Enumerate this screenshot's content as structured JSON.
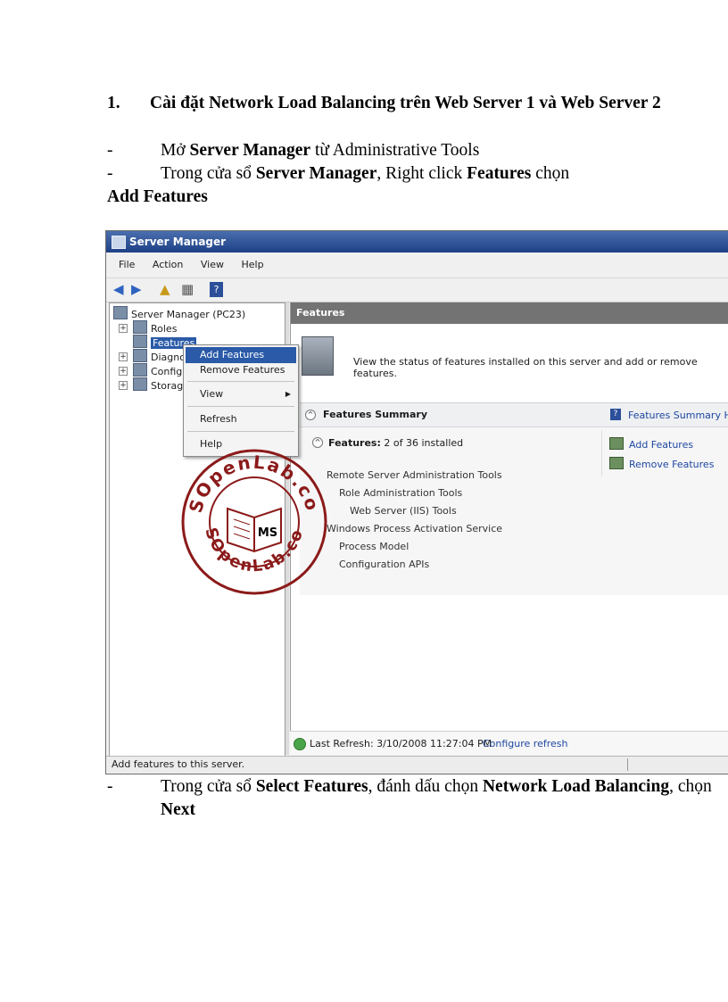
{
  "doc": {
    "heading_num": "1.",
    "heading_text": "Cài đặt Network Load Balancing trên Web Server 1 và Web Server 2",
    "steps": [
      {
        "dash": "-",
        "t1": "Mở ",
        "b1": "Server Manager",
        "t2": " từ Administrative Tools"
      },
      {
        "dash": "-",
        "t1": "Trong cửa sổ ",
        "b1": "Server Manager",
        "t2": ", Right click ",
        "b2": "Features",
        "t3": " chọn ",
        "b3": "Add Features"
      },
      {
        "dash": "-",
        "t1": "Trong cửa sổ ",
        "b1": "Select Features",
        "t2": ", đánh dấu chọn ",
        "b2": "Network Load Balancing",
        "t3": ", chọn ",
        "b3": "Next"
      }
    ]
  },
  "window": {
    "title": "Server Manager",
    "menu": [
      "File",
      "Action",
      "View",
      "Help"
    ],
    "toolbar": {
      "back": "◀",
      "forward": "▶",
      "up": "▲",
      "grid": "▦",
      "help": "?"
    },
    "tree": [
      {
        "label": "Server Manager (PC23)",
        "expander": ""
      },
      {
        "label": "Roles",
        "expander": "+"
      },
      {
        "label": "Features",
        "expander": ""
      },
      {
        "label": "Diagnos",
        "expander": "+"
      },
      {
        "label": "Configu",
        "expander": "+"
      },
      {
        "label": "Storage",
        "expander": "+"
      }
    ],
    "right_header": "Features",
    "banner_text": "View the status of features installed on this server and add or remove features.",
    "summary": {
      "title": "Features Summary",
      "help_link": "Features Summary Help",
      "features_label": "Features:",
      "features_count": "2 of 36 installed",
      "items": [
        "Remote Server Administration Tools",
        "Role Administration Tools",
        "Web Server (IIS) Tools",
        "Windows Process Activation Service",
        "Process Model",
        "Configuration APIs"
      ],
      "actions": [
        "Add Features",
        "Remove Features"
      ]
    },
    "last_refresh": "Last Refresh: 3/10/2008 11:27:04 PM",
    "configure_refresh": "Configure refresh",
    "statusbar": "Add features to this server."
  },
  "context_menu": [
    {
      "label": "Add Features",
      "highlight": true
    },
    {
      "label": "Remove Features"
    },
    {
      "label": "View",
      "submenu": "▶"
    },
    {
      "label": "Refresh"
    },
    {
      "label": "Help"
    }
  ],
  "watermark": {
    "ring_top": "MSOpenLab.com",
    "ring_bottom": "MSOpenLab.com",
    "center": "MS",
    "color": "#8b1a1a"
  }
}
